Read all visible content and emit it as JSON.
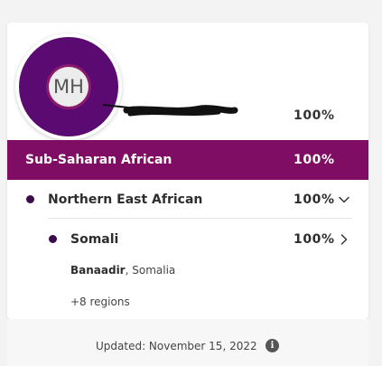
{
  "profile": {
    "initials": "MH",
    "total_percent": "100%"
  },
  "region": {
    "label": "Sub-Saharan African",
    "percent": "100%"
  },
  "subregion": {
    "label": "Northern East African",
    "percent": "100%",
    "chevron": "chevron-down-icon"
  },
  "population": {
    "label": "Somali",
    "percent": "100%",
    "chevron": "chevron-right-icon",
    "location_bold": "Banaadir",
    "location_rest": ", Somalia",
    "more_regions": "+8 regions"
  },
  "footer": {
    "updated": "Updated: November 15, 2022",
    "info_icon": "info-icon"
  },
  "colors": {
    "accent": "#7f0d63",
    "avatar_ring": "#5a0a70",
    "dot": "#3d0a4a"
  }
}
